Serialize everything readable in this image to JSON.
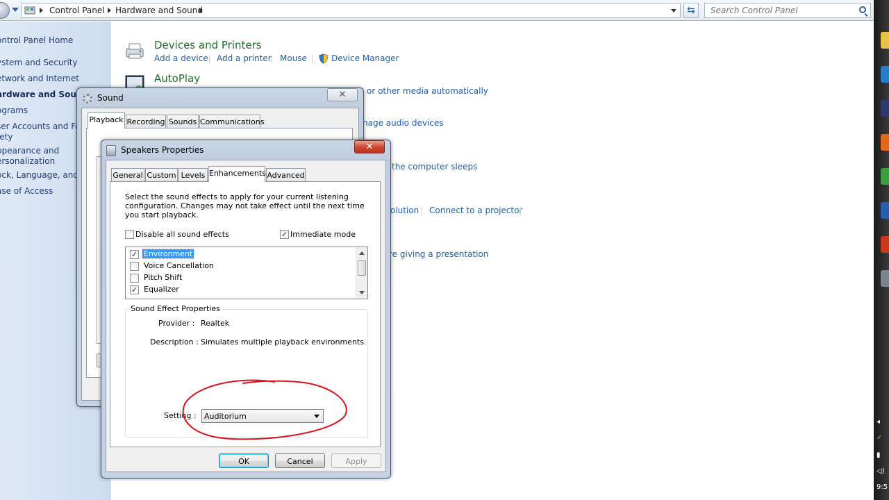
{
  "breadcrumb": {
    "items": [
      "Control Panel",
      "Hardware and Sound"
    ]
  },
  "search": {
    "placeholder": "Search Control Panel"
  },
  "sidebar": {
    "items": [
      {
        "label": "ontrol Panel Home"
      },
      {
        "label": "ystem and Security"
      },
      {
        "label": "etwork and Internet"
      },
      {
        "label": "ardware and Sound"
      },
      {
        "label": "ograms"
      },
      {
        "label": "ser Accounts and Fam"
      },
      {
        "label": "fety"
      },
      {
        "label": "ppearance and"
      },
      {
        "label": "ersonalization"
      },
      {
        "label": "ock, Language, and R"
      },
      {
        "label": "ase of Access"
      }
    ]
  },
  "main": {
    "devices_printers": {
      "title": "Devices and Printers",
      "links": [
        "Add a device",
        "Add a printer",
        "Mouse",
        "Device Manager"
      ]
    },
    "autoplay": {
      "title": "AutoPlay",
      "partial_link": "or other media automatically"
    },
    "sound_partial_link": "nage audio devices",
    "power_partial_link": "the computer sleeps",
    "display_links": [
      "olution",
      "Connect to a projector"
    ],
    "presentation_partial_link": "re giving a presentation"
  },
  "sound_dialog": {
    "title": "Sound",
    "tabs": [
      "Playback",
      "Recording",
      "Sounds",
      "Communications"
    ],
    "close": "✕"
  },
  "speakers_dialog": {
    "title": "Speakers Properties",
    "close": "✕",
    "tabs": [
      "General",
      "Custom",
      "Levels",
      "Enhancements",
      "Advanced"
    ],
    "active_tab": "Enhancements",
    "instructions": "Select the sound effects to apply for your current listening configuration. Changes may not take effect until the next time you start playback.",
    "disable_all_label": "Disable all sound effects",
    "immediate_mode_label": "Immediate mode",
    "disable_all_checked": false,
    "immediate_mode_checked": true,
    "effects": [
      {
        "name": "Environment",
        "checked": true,
        "selected": true
      },
      {
        "name": "Voice Cancellation",
        "checked": false,
        "selected": false
      },
      {
        "name": "Pitch Shift",
        "checked": false,
        "selected": false
      },
      {
        "name": "Equalizer",
        "checked": true,
        "selected": false
      }
    ],
    "properties_group_title": "Sound Effect Properties",
    "provider_label": "Provider :",
    "provider_value": "Realtek",
    "description_label": "Description :",
    "description_value": "Simulates multiple playback environments.",
    "setting_label": "Setting :",
    "setting_value": "Auditorium",
    "buttons": {
      "ok": "OK",
      "cancel": "Cancel",
      "apply": "Apply"
    }
  },
  "taskbar": {
    "clock_partial": "9:5"
  },
  "colors": {
    "link": "#1f5fae",
    "category_title": "#1e6e28",
    "annotation_circle": "#d8141c",
    "selection": "#3399ff"
  }
}
